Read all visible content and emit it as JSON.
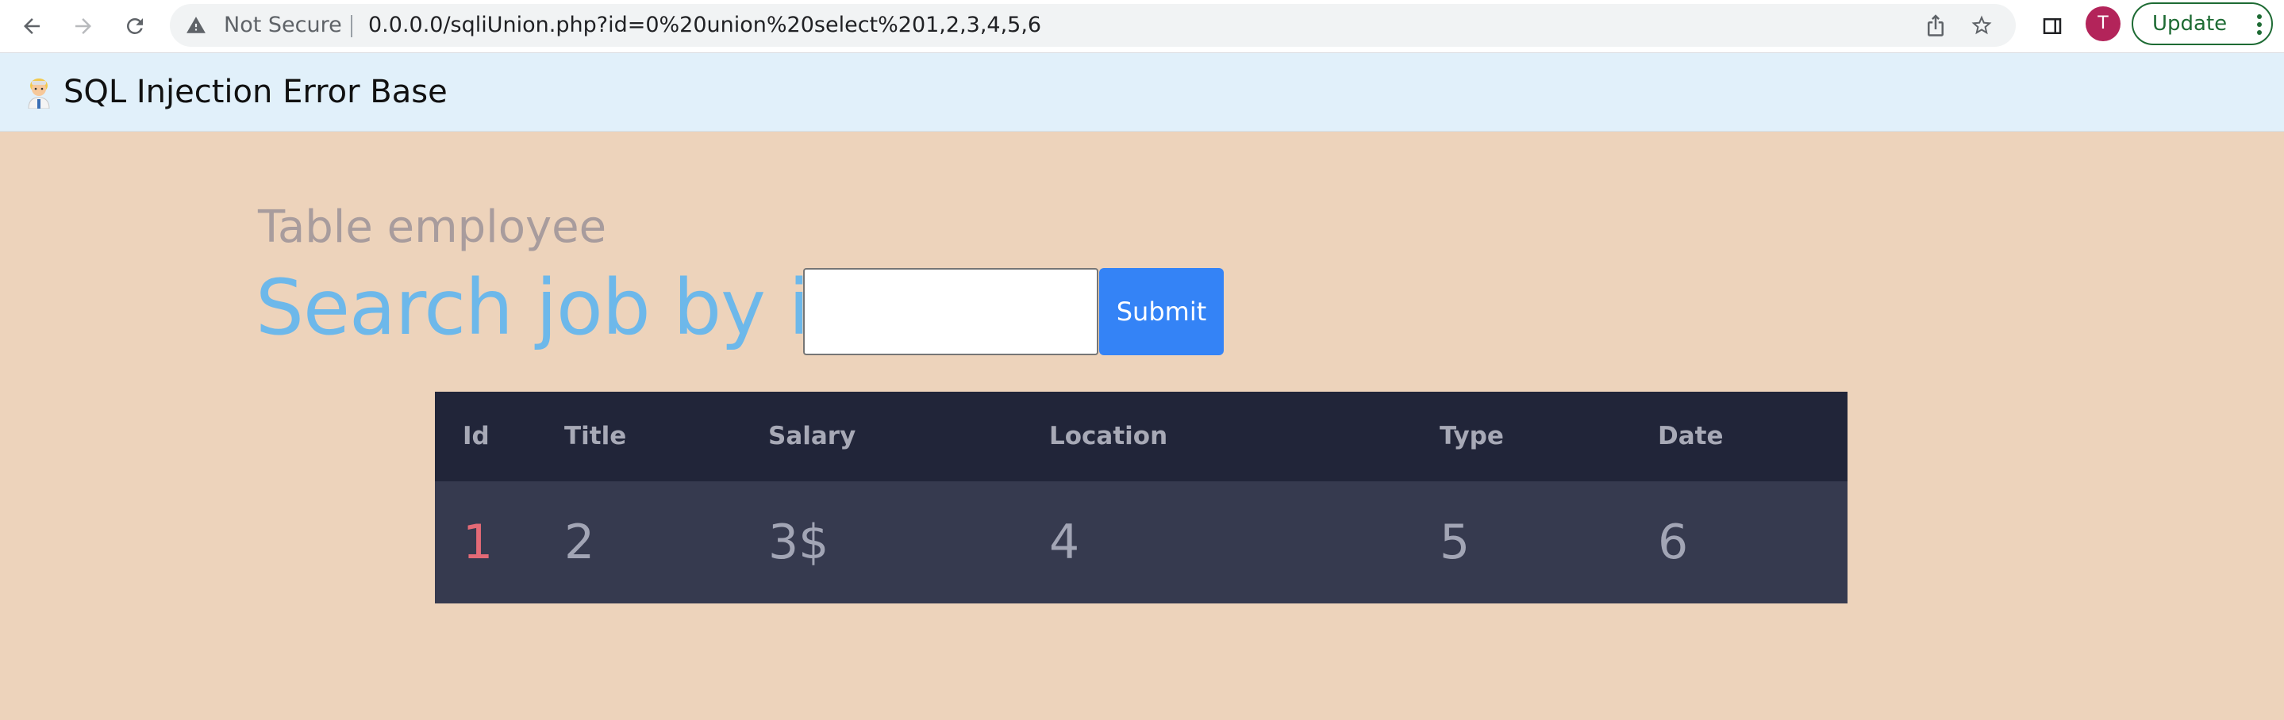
{
  "browser": {
    "security_label": "Not Secure",
    "url": "0.0.0.0/sqliUnion.php?id=0%20union%20select%201,2,3,4,5,6",
    "profile_initial": "T",
    "update_label": "Update",
    "icons": [
      "back-arrow-icon",
      "forward-arrow-icon",
      "reload-icon",
      "warning-icon",
      "share-icon",
      "star-icon",
      "side-panel-icon",
      "kebab-menu-icon"
    ]
  },
  "navbar": {
    "brand_icon": "scientist-emoji-icon",
    "title": "SQL Injection Error Base"
  },
  "main": {
    "subheading": "Table employee",
    "heading": "Search job by id",
    "search_input": {
      "value": "",
      "placeholder": ""
    },
    "submit_label": "Submit"
  },
  "table": {
    "headers": [
      "Id",
      "Title",
      "Salary",
      "Location",
      "Type",
      "Date"
    ],
    "rows": [
      [
        "1",
        "2",
        "3$",
        "4",
        "5",
        "6"
      ]
    ]
  },
  "colors": {
    "page_background": "#edd3bb",
    "navbar_background": "#e1f0fa",
    "heading": "#6db8ea",
    "submit_button": "#3483f6",
    "table_header": "#212539",
    "table_row": "#363a4f",
    "id_cell": "#e46a76"
  }
}
